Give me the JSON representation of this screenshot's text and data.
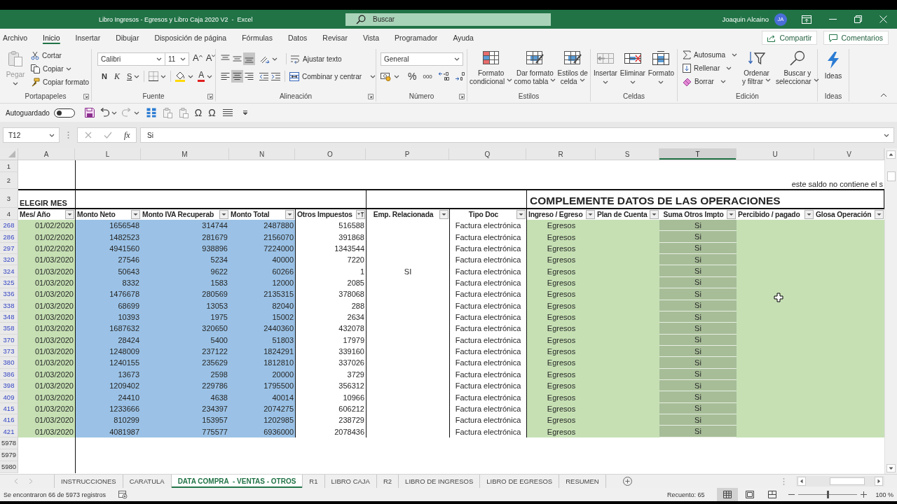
{
  "window": {
    "title": "Libro Ingresos - Egresos y Libro Caja 2020 V2  -  Excel",
    "search": {
      "placeholder": "Buscar"
    },
    "user": "Joaquin Alcaino",
    "avatar": "JA"
  },
  "menu_tabs": [
    {
      "label": "Archivo",
      "selected": false
    },
    {
      "label": "Inicio",
      "selected": true
    },
    {
      "label": "Insertar",
      "selected": false
    },
    {
      "label": "Dibujar",
      "selected": false
    },
    {
      "label": "Disposición de página",
      "selected": false
    },
    {
      "label": "Fórmulas",
      "selected": false
    },
    {
      "label": "Datos",
      "selected": false
    },
    {
      "label": "Revisar",
      "selected": false
    },
    {
      "label": "Vista",
      "selected": false
    },
    {
      "label": "Programador",
      "selected": false
    },
    {
      "label": "Ayuda",
      "selected": false
    }
  ],
  "header_buttons": {
    "share": "Compartir",
    "comments": "Comentarios"
  },
  "ribbon": {
    "clipboard": {
      "label": "Portapapeles",
      "paste": {
        "label": "Pegar",
        "disabled": true
      },
      "cut": "Cortar",
      "copy": "Copiar",
      "format_painter": "Copiar formato"
    },
    "font": {
      "label": "Fuente",
      "font_name": "Calibri",
      "font_size": "11",
      "grow_font": "A",
      "shrink_font": "A",
      "bold": "N",
      "italic": "K",
      "underline": "S",
      "font_color": "A"
    },
    "alignment": {
      "label": "Alineación",
      "vertical": [
        {
          "selected": false
        },
        {
          "selected": false
        },
        {
          "selected": true
        }
      ],
      "horizontal": [
        {
          "selected": false
        },
        {
          "selected": true
        },
        {
          "selected": false
        }
      ],
      "wrap_text": "Ajustar texto",
      "merge_center": "Combinar y centrar"
    },
    "number": {
      "label": "Número",
      "format": "General",
      "percent": "%",
      "thousands": "000"
    },
    "styles": {
      "label": "Estilos",
      "buttons": [
        {
          "lines": [
            "Formato",
            "condicional"
          ]
        },
        {
          "lines": [
            "Dar formato",
            "como tabla"
          ]
        },
        {
          "lines": [
            "Estilos de",
            "celda"
          ]
        }
      ]
    },
    "cells": {
      "label": "Celdas",
      "buttons": [
        "Insertar",
        "Eliminar",
        "Formato"
      ]
    },
    "editing": {
      "label": "Edición",
      "autosum": "Autosuma",
      "fill": "Rellenar",
      "clear": "Borrar",
      "sort_filter": [
        "Ordenar",
        "y filtrar"
      ],
      "find_select": [
        "Buscar y",
        "seleccionar"
      ]
    },
    "ideas": {
      "label": "Ideas",
      "button": "Ideas"
    }
  },
  "quick_access": {
    "autosave": {
      "label": "Autoguardado",
      "on": false
    },
    "symbols": [
      "Ω",
      "Ω"
    ]
  },
  "formula_bar": {
    "name_box": "T12",
    "function_button": "fx",
    "formula": "Si"
  },
  "sheet": {
    "columns": [
      {
        "letter": "A",
        "selected": false
      },
      {
        "letter": "L",
        "selected": false
      },
      {
        "letter": "M",
        "selected": false
      },
      {
        "letter": "N",
        "selected": false
      },
      {
        "letter": "O",
        "selected": false
      },
      {
        "letter": "P",
        "selected": false
      },
      {
        "letter": "Q",
        "selected": false
      },
      {
        "letter": "R",
        "selected": false
      },
      {
        "letter": "S",
        "selected": false
      },
      {
        "letter": "T",
        "selected": true
      },
      {
        "letter": "U",
        "selected": false
      },
      {
        "letter": "V",
        "selected": false
      }
    ],
    "title_rows": [
      {
        "kind": "blank",
        "number": "1"
      },
      {
        "kind": "note",
        "number": "2",
        "note": "este saldo no contiene el s"
      },
      {
        "kind": "title",
        "number": "3",
        "choose_month": "ELEGIR MES",
        "section_title": "COMPLEMENTE DATOS DE LAS OPERACIONES"
      }
    ],
    "header_row": {
      "number": "4",
      "headers": [
        {
          "label": "Mes/ Año",
          "filtered": false
        },
        {
          "label": "Monto Neto",
          "filtered": false
        },
        {
          "label": "Monto IVA Recuperab",
          "filtered": false
        },
        {
          "label": "Monto Total",
          "filtered": false
        },
        {
          "label": "Otros Impuestos",
          "filtered": true
        },
        {
          "label": "Emp. Relacionada",
          "filtered": false
        },
        {
          "label": "Tipo Doc",
          "filtered": false
        },
        {
          "label": "Ingreso / Egreso",
          "filtered": false
        },
        {
          "label": "Plan de Cuenta",
          "filtered": false
        },
        {
          "label": "Suma Otros Impto",
          "filtered": false
        },
        {
          "label": "Percibido / pagado",
          "filtered": false
        },
        {
          "label": "Glosa Operación",
          "filtered": false
        }
      ]
    },
    "rows": [
      {
        "number": "268",
        "mes_ano": "01/02/2020",
        "monto_neto": "1656548",
        "monto_iva": "314744",
        "monto_total": "2487880",
        "otros_impuestos": "516588",
        "tipo_doc": "Factura electrónica",
        "ingreso_egreso": "Egresos",
        "suma_otros_impto": "Si"
      },
      {
        "number": "286",
        "mes_ano": "01/02/2020",
        "monto_neto": "1482523",
        "monto_iva": "281679",
        "monto_total": "2156070",
        "otros_impuestos": "391868",
        "tipo_doc": "Factura electrónica",
        "ingreso_egreso": "Egresos",
        "suma_otros_impto": "Si"
      },
      {
        "number": "297",
        "mes_ano": "01/02/2020",
        "monto_neto": "4941560",
        "monto_iva": "938896",
        "monto_total": "7224000",
        "otros_impuestos": "1343544",
        "tipo_doc": "Factura electrónica",
        "ingreso_egreso": "Egresos",
        "suma_otros_impto": "Si"
      },
      {
        "number": "320",
        "mes_ano": "01/03/2020",
        "monto_neto": "27546",
        "monto_iva": "5234",
        "monto_total": "40000",
        "otros_impuestos": "7220",
        "tipo_doc": "Factura electrónica",
        "ingreso_egreso": "Egresos",
        "suma_otros_impto": "Si"
      },
      {
        "number": "324",
        "mes_ano": "01/03/2020",
        "monto_neto": "50643",
        "monto_iva": "9622",
        "monto_total": "60266",
        "otros_impuestos": "1",
        "emp_relacionada": "SI",
        "tipo_doc": "Factura electrónica",
        "ingreso_egreso": "Egresos",
        "suma_otros_impto": "Si"
      },
      {
        "number": "325",
        "mes_ano": "01/03/2020",
        "monto_neto": "8332",
        "monto_iva": "1583",
        "monto_total": "12000",
        "otros_impuestos": "2085",
        "tipo_doc": "Factura electrónica",
        "ingreso_egreso": "Egresos",
        "suma_otros_impto": "Si"
      },
      {
        "number": "336",
        "mes_ano": "01/03/2020",
        "monto_neto": "1476678",
        "monto_iva": "280569",
        "monto_total": "2135315",
        "otros_impuestos": "378068",
        "tipo_doc": "Factura electrónica",
        "ingreso_egreso": "Egresos",
        "suma_otros_impto": "Si"
      },
      {
        "number": "338",
        "mes_ano": "01/03/2020",
        "monto_neto": "68699",
        "monto_iva": "13053",
        "monto_total": "82040",
        "otros_impuestos": "288",
        "tipo_doc": "Factura electrónica",
        "ingreso_egreso": "Egresos",
        "suma_otros_impto": "Si"
      },
      {
        "number": "348",
        "mes_ano": "01/03/2020",
        "monto_neto": "10393",
        "monto_iva": "1975",
        "monto_total": "15002",
        "otros_impuestos": "2634",
        "tipo_doc": "Factura electrónica",
        "ingreso_egreso": "Egresos",
        "suma_otros_impto": "Si"
      },
      {
        "number": "358",
        "mes_ano": "01/03/2020",
        "monto_neto": "1687632",
        "monto_iva": "320650",
        "monto_total": "2440360",
        "otros_impuestos": "432078",
        "tipo_doc": "Factura electrónica",
        "ingreso_egreso": "Egresos",
        "suma_otros_impto": "Si"
      },
      {
        "number": "370",
        "mes_ano": "01/03/2020",
        "monto_neto": "28424",
        "monto_iva": "5400",
        "monto_total": "51803",
        "otros_impuestos": "17979",
        "tipo_doc": "Factura electrónica",
        "ingreso_egreso": "Egresos",
        "suma_otros_impto": "Si"
      },
      {
        "number": "373",
        "mes_ano": "01/03/2020",
        "monto_neto": "1248009",
        "monto_iva": "237122",
        "monto_total": "1824291",
        "otros_impuestos": "339160",
        "tipo_doc": "Factura electrónica",
        "ingreso_egreso": "Egresos",
        "suma_otros_impto": "Si"
      },
      {
        "number": "380",
        "mes_ano": "01/03/2020",
        "monto_neto": "1240155",
        "monto_iva": "235629",
        "monto_total": "1812810",
        "otros_impuestos": "337026",
        "tipo_doc": "Factura electrónica",
        "ingreso_egreso": "Egresos",
        "suma_otros_impto": "Si"
      },
      {
        "number": "386",
        "mes_ano": "01/03/2020",
        "monto_neto": "13673",
        "monto_iva": "2598",
        "monto_total": "20000",
        "otros_impuestos": "3729",
        "tipo_doc": "Factura electrónica",
        "ingreso_egreso": "Egresos",
        "suma_otros_impto": "Si"
      },
      {
        "number": "398",
        "mes_ano": "01/03/2020",
        "monto_neto": "1209402",
        "monto_iva": "229786",
        "monto_total": "1795500",
        "otros_impuestos": "356312",
        "tipo_doc": "Factura electrónica",
        "ingreso_egreso": "Egresos",
        "suma_otros_impto": "Si"
      },
      {
        "number": "409",
        "mes_ano": "01/03/2020",
        "monto_neto": "24410",
        "monto_iva": "4638",
        "monto_total": "40014",
        "otros_impuestos": "10966",
        "tipo_doc": "Factura electrónica",
        "ingreso_egreso": "Egresos",
        "suma_otros_impto": "Si"
      },
      {
        "number": "415",
        "mes_ano": "01/03/2020",
        "monto_neto": "1233666",
        "monto_iva": "234397",
        "monto_total": "2074275",
        "otros_impuestos": "606212",
        "tipo_doc": "Factura electrónica",
        "ingreso_egreso": "Egresos",
        "suma_otros_impto": "Si"
      },
      {
        "number": "416",
        "mes_ano": "01/03/2020",
        "monto_neto": "810299",
        "monto_iva": "153957",
        "monto_total": "1202985",
        "otros_impuestos": "238729",
        "tipo_doc": "Factura electrónica",
        "ingreso_egreso": "Egresos",
        "suma_otros_impto": "Si"
      },
      {
        "number": "421",
        "mes_ano": "01/03/2020",
        "monto_neto": "4081987",
        "monto_iva": "775577",
        "monto_total": "6936000",
        "otros_impuestos": "2078436",
        "tipo_doc": "Factura electrónica",
        "ingreso_egreso": "Egresos",
        "suma_otros_impto": "Si"
      }
    ],
    "empty_rows": [
      "5978",
      "5979",
      "5980"
    ]
  },
  "sheet_tabs": [
    {
      "label": "INSTRUCCIONES",
      "selected": false
    },
    {
      "label": "CARATULA",
      "selected": false
    },
    {
      "label": "DATA COMPRA  - VENTAS - OTROS",
      "selected": true
    },
    {
      "label": "R1",
      "selected": false
    },
    {
      "label": "LIBRO CAJA",
      "selected": false
    },
    {
      "label": "R2",
      "selected": false
    },
    {
      "label": "LIBRO DE INGRESOS",
      "selected": false
    },
    {
      "label": "LIBRO DE EGRESOS",
      "selected": false
    },
    {
      "label": "RESUMEN",
      "selected": false
    }
  ],
  "status_bar": {
    "message": "Se encontraron 66 de 5973 registros",
    "count": "Recuento: 65",
    "views": [
      {
        "selected": true
      },
      {
        "selected": false
      },
      {
        "selected": false
      }
    ],
    "zoom": {
      "level": 0.5,
      "label": "100 %"
    }
  }
}
